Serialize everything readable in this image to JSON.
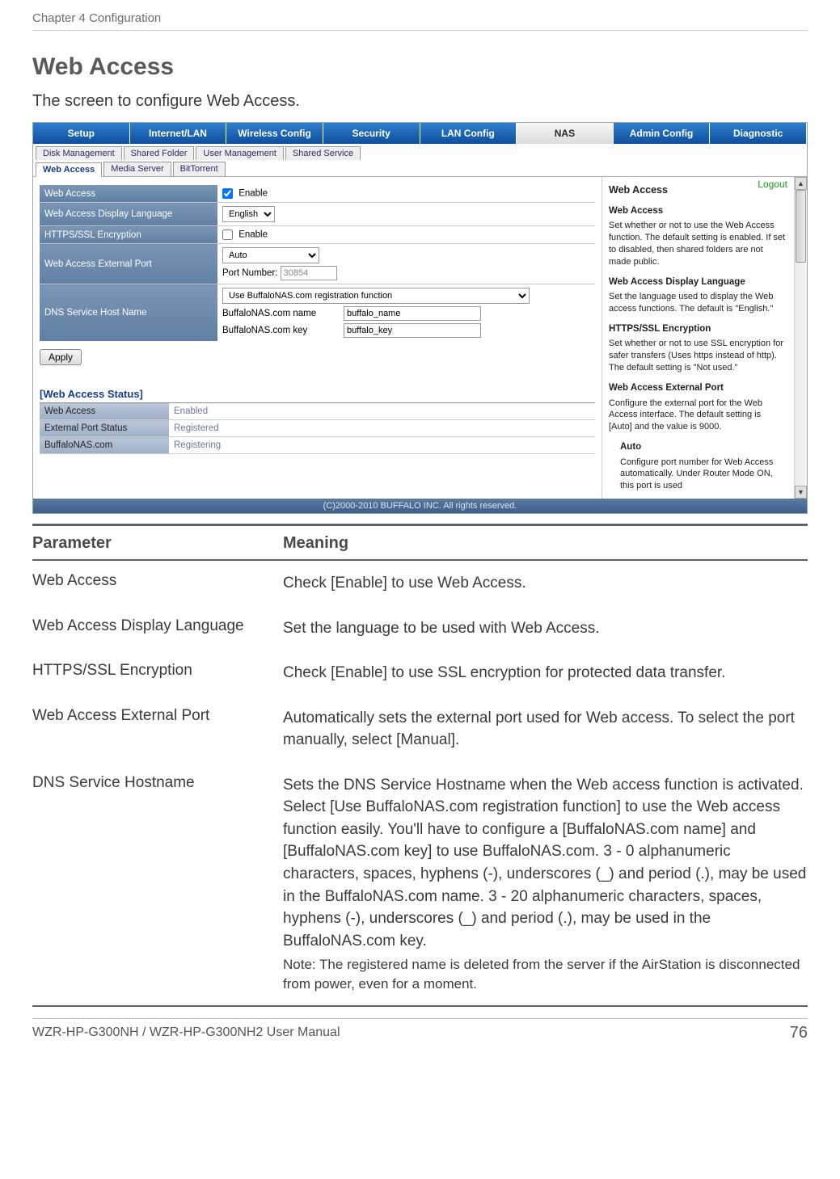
{
  "page": {
    "chapterHeader": "Chapter 4  Configuration",
    "sectionTitle": "Web Access",
    "intro": "The screen to configure Web Access.",
    "footerLeft": "WZR-HP-G300NH / WZR-HP-G300NH2 User Manual",
    "pageNumber": "76"
  },
  "tabs": {
    "main": [
      "Setup",
      "Internet/LAN",
      "Wireless Config",
      "Security",
      "LAN Config",
      "NAS",
      "Admin Config",
      "Diagnostic"
    ],
    "activeMain": 5,
    "subRow1": [
      "Disk Management",
      "Shared Folder",
      "User Management",
      "Shared Service"
    ],
    "subRow2": [
      "Web Access",
      "Media Server",
      "BitTorrent"
    ],
    "activeSub": "Web Access",
    "logout": "Logout"
  },
  "settings": {
    "rows": {
      "webAccess": {
        "label": "Web Access",
        "enableText": "Enable",
        "checked": true
      },
      "displayLang": {
        "label": "Web Access Display Language",
        "value": "English"
      },
      "ssl": {
        "label": "HTTPS/SSL Encryption",
        "enableText": "Enable",
        "checked": false
      },
      "extPort": {
        "label": "Web Access External Port",
        "mode": "Auto",
        "portLabel": "Port Number:",
        "portValue": "30854"
      },
      "dns": {
        "label": "DNS Service Host Name",
        "mode": "Use BuffaloNAS.com registration function",
        "nameLabel": "BuffaloNAS.com name",
        "nameValue": "buffalo_name",
        "keyLabel": "BuffaloNAS.com key",
        "keyValue": "buffalo_key"
      }
    },
    "applyLabel": "Apply"
  },
  "status": {
    "heading": "[Web Access Status]",
    "rows": [
      {
        "label": "Web Access",
        "value": "Enabled"
      },
      {
        "label": "External Port Status",
        "value": "Registered"
      },
      {
        "label": "BuffaloNAS.com",
        "value": "Registering"
      }
    ]
  },
  "copyright": "(C)2000-2010 BUFFALO INC. All rights reserved.",
  "help": {
    "title": "Web Access",
    "items": [
      {
        "h": "Web Access",
        "p": "Set whether or not to use the Web Access function. The default setting is enabled. If set to disabled, then shared folders are not made public."
      },
      {
        "h": "Web Access Display Language",
        "p": "Set the language used to display the Web access functions. The default is \"English.\""
      },
      {
        "h": "HTTPS/SSL Encryption",
        "p": "Set whether or not to use SSL encryption for safer transfers (Uses https instead of http). The default setting is \"Not used.\""
      },
      {
        "h": "Web Access External Port",
        "p": "Configure the external port for the Web Access interface. The default setting is [Auto] and the value is 9000."
      },
      {
        "subh": "Auto",
        "subp": "Configure port number for Web Access automatically. Under Router Mode ON, this port is used"
      }
    ]
  },
  "paramTable": {
    "headers": {
      "c1": "Parameter",
      "c2": "Meaning"
    },
    "rows": [
      {
        "p": "Web Access",
        "m": "Check [Enable] to use Web Access."
      },
      {
        "p": "Web Access Display Language",
        "m": "Set the language to be used with Web Access."
      },
      {
        "p": "HTTPS/SSL Encryption",
        "m": "Check [Enable] to use SSL encryption for protected data transfer."
      },
      {
        "p": "Web Access External Port",
        "m": "Automatically sets the external port used for Web access.  To select the port manually, select [Manual]."
      },
      {
        "p": "DNS Service Hostname",
        "m": "Sets the DNS Service Hostname when the Web access function is activated.  Select [Use BuffaloNAS.com registration function] to use the Web access function easily.  You'll have to configure a [BuffaloNAS.com name] and [BuffaloNAS.com key] to use BuffaloNAS.com.  3 - 0 alphanumeric characters, spaces, hyphens (-), underscores (_) and period (.), may be used in the BuffaloNAS.com name.  3 - 20 alphanumeric characters, spaces, hyphens (-), underscores (_) and period (.), may be used in the BuffaloNAS.com key.",
        "note": "Note:     The registered name is deleted from the server if the AirStation is disconnected from power, even for a moment."
      }
    ]
  }
}
